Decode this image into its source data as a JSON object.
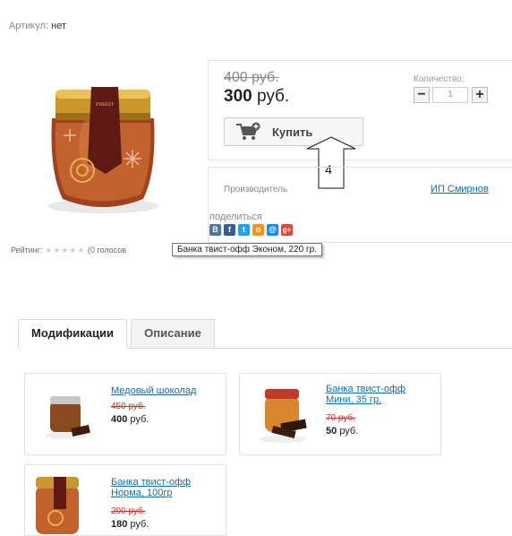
{
  "sku": {
    "label": "Артикул:",
    "value": "нет"
  },
  "product": {
    "image": "jar-twist-off-image"
  },
  "price_box": {
    "old_price": "400 руб.",
    "price_number": "300",
    "price_currency": "руб.",
    "qty_label": "Количество:",
    "qty_value": "1",
    "minus": "−",
    "plus": "+",
    "buy_label": "Купить"
  },
  "maker": {
    "label": "Производитель",
    "value": "ИП Смирнов",
    "share_label": "поделиться",
    "social": [
      {
        "icon": "vk-icon",
        "glyph": "B",
        "color": "#4a76a8"
      },
      {
        "icon": "facebook-icon",
        "glyph": "f",
        "color": "#3b5998"
      },
      {
        "icon": "twitter-icon",
        "glyph": "t",
        "color": "#1da1f2"
      },
      {
        "icon": "odnoklassniki-icon",
        "glyph": "o",
        "color": "#f7931e"
      },
      {
        "icon": "mailru-icon",
        "glyph": "@",
        "color": "#168de2"
      },
      {
        "icon": "googleplus-icon",
        "glyph": "g+",
        "color": "#dd4b39"
      }
    ]
  },
  "rating": {
    "label": "Рейтинг:",
    "stars": "★★★★★",
    "votes": "(0 голосов"
  },
  "tooltip": "Банка твист-офф Эконом, 220 гр.",
  "callout": {
    "number": "4"
  },
  "tabs": [
    {
      "label": "Модификации"
    },
    {
      "label": "Описание"
    }
  ],
  "modifications": [
    {
      "title": "Медовый шоколад",
      "old_price": "450 руб.",
      "price_number": "400",
      "price_currency": "руб."
    },
    {
      "title_line1": "Банка твист-офф",
      "title_line2": "Мини, 35 гр.",
      "old_price": "70 руб.",
      "price_number": "50",
      "price_currency": "руб."
    },
    {
      "title_line1": "Банка твист-офф",
      "title_line2": "Норма, 100гр",
      "old_price": "200 руб.",
      "price_number": "180",
      "price_currency": "руб."
    }
  ],
  "colors": {
    "link": "#1a6aa8",
    "old_price_red": "#c0392b"
  }
}
